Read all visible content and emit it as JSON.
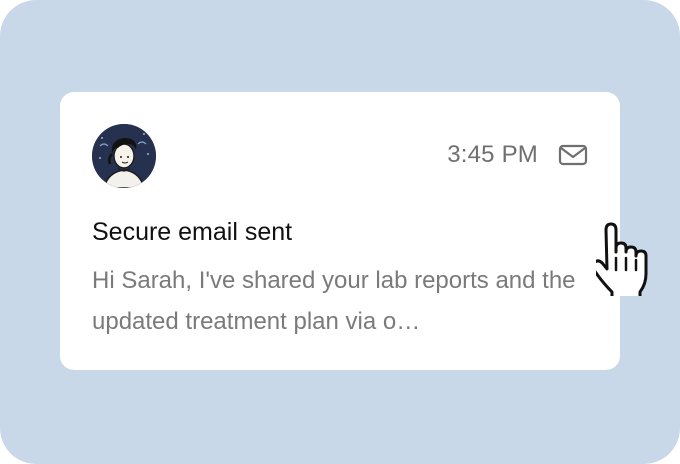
{
  "notification": {
    "time": "3:45 PM",
    "title": "Secure email sent",
    "preview": "Hi Sarah, I've shared your lab reports and the updated treatment plan via o…",
    "icons": {
      "status": "mail-icon",
      "avatar": "avatar-illustration",
      "pointer": "hand-pointer-cursor-icon"
    }
  },
  "colors": {
    "background": "#c9d8e8",
    "card": "#ffffff",
    "title": "#111111",
    "muted": "#7a7a7a"
  }
}
